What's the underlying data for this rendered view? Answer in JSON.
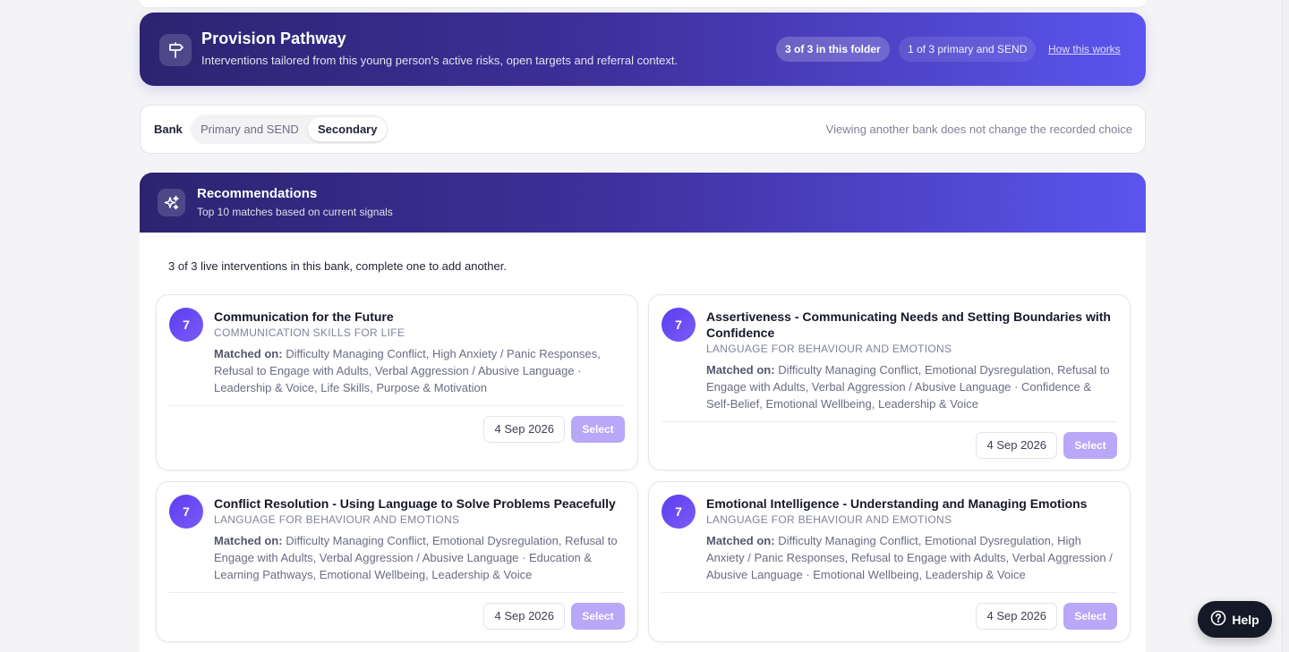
{
  "pathway": {
    "title": "Provision Pathway",
    "subtitle": "Interventions tailored from this young person's active risks, open targets and referral context.",
    "folder_pill": "3 of 3 in this folder",
    "primary_pill": "1 of 3 primary and SEND",
    "how_link": "How this works",
    "icon": "signpost-icon"
  },
  "bank": {
    "label": "Bank",
    "options": [
      "Primary and SEND",
      "Secondary"
    ],
    "selected": "Secondary",
    "note": "Viewing another bank does not change the recorded choice"
  },
  "recommendations": {
    "title": "Recommendations",
    "subtitle": "Top 10 matches based on current signals",
    "icon": "sparkles-icon",
    "live_note": "3 of 3 live interventions in this bank, complete one to add another.",
    "matched_label": "Matched on:",
    "cards": [
      {
        "score": "7",
        "title": "Communication for the Future",
        "category": "COMMUNICATION SKILLS FOR LIFE",
        "matched": "Difficulty Managing Conflict, High Anxiety / Panic Responses, Refusal to Engage with Adults, Verbal Aggression / Abusive Language · Leadership & Voice, Life Skills, Purpose & Motivation",
        "date": "4 Sep 2026",
        "select": "Select"
      },
      {
        "score": "7",
        "title": "Assertiveness - Communicating Needs and Setting Boundaries with Confidence",
        "category": "LANGUAGE FOR BEHAVIOUR AND EMOTIONS",
        "matched": "Difficulty Managing Conflict, Emotional Dysregulation, Refusal to Engage with Adults, Verbal Aggression / Abusive Language · Confidence & Self-Belief, Emotional Wellbeing, Leadership & Voice",
        "date": "4 Sep 2026",
        "select": "Select"
      },
      {
        "score": "7",
        "title": "Conflict Resolution - Using Language to Solve Problems Peacefully",
        "category": "LANGUAGE FOR BEHAVIOUR AND EMOTIONS",
        "matched": "Difficulty Managing Conflict, Emotional Dysregulation, Refusal to Engage with Adults, Verbal Aggression / Abusive Language · Education & Learning Pathways, Emotional Wellbeing, Leadership & Voice",
        "date": "4 Sep 2026",
        "select": "Select"
      },
      {
        "score": "7",
        "title": "Emotional Intelligence - Understanding and Managing Emotions",
        "category": "LANGUAGE FOR BEHAVIOUR AND EMOTIONS",
        "matched": "Difficulty Managing Conflict, Emotional Dysregulation, High Anxiety / Panic Responses, Refusal to Engage with Adults, Verbal Aggression / Abusive Language · Emotional Wellbeing, Leadership & Voice",
        "date": "4 Sep 2026",
        "select": "Select"
      }
    ]
  },
  "help": {
    "label": "Help",
    "icon": "question-circle-icon"
  }
}
